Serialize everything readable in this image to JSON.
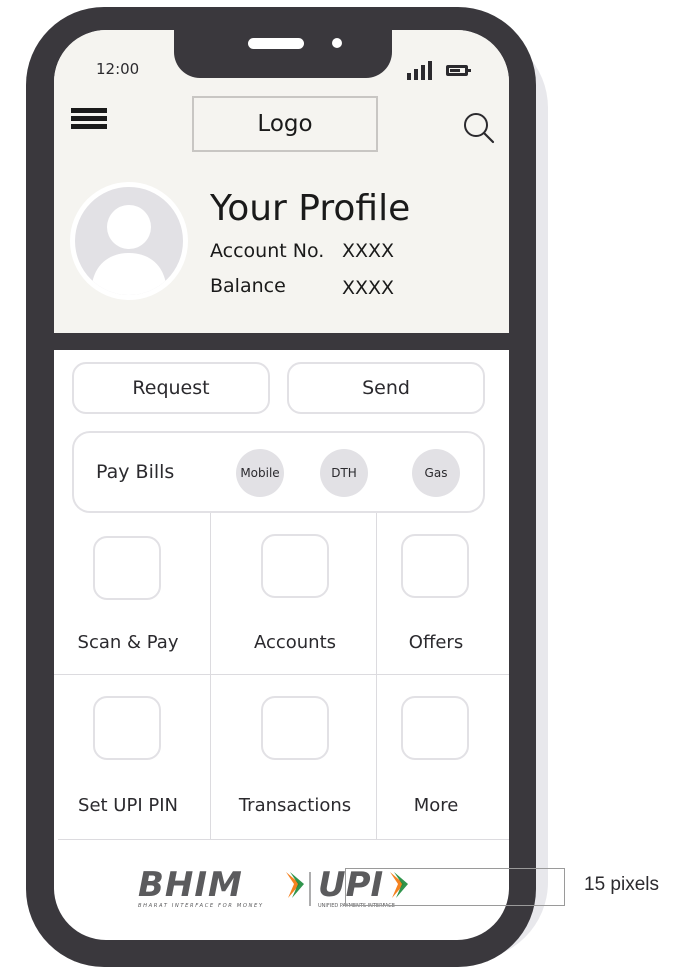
{
  "status_bar": {
    "time": "12:00"
  },
  "header": {
    "logo_label": "Logo"
  },
  "profile": {
    "title": "Your Profile",
    "account_label": "Account No.",
    "account_value": "XXXX",
    "balance_label": "Balance",
    "balance_value": "XXXX"
  },
  "actions": {
    "request_label": "Request",
    "send_label": "Send"
  },
  "pay_bills": {
    "label": "Pay Bills",
    "options": [
      "Mobile",
      "DTH",
      "Gas"
    ]
  },
  "tiles": [
    {
      "label": "Scan & Pay"
    },
    {
      "label": "Accounts"
    },
    {
      "label": "Offers"
    },
    {
      "label": "Set UPI PIN"
    },
    {
      "label": "Transactions"
    },
    {
      "label": "More"
    }
  ],
  "footer": {
    "bhim_text": "BHIM",
    "bhim_tagline": "BHARAT INTERFACE FOR MONEY",
    "upi_text": "UPI",
    "upi_tagline": "UNIFIED PAYMENTS INTERFACE"
  },
  "annotation": {
    "text": "15 pixels"
  },
  "colors": {
    "phone_frame": "#3a383d",
    "header_bg": "#f5f4f0",
    "chip_bg": "#e2e1e5",
    "logo_orange": "#f58220",
    "logo_green": "#1b8a3a"
  }
}
